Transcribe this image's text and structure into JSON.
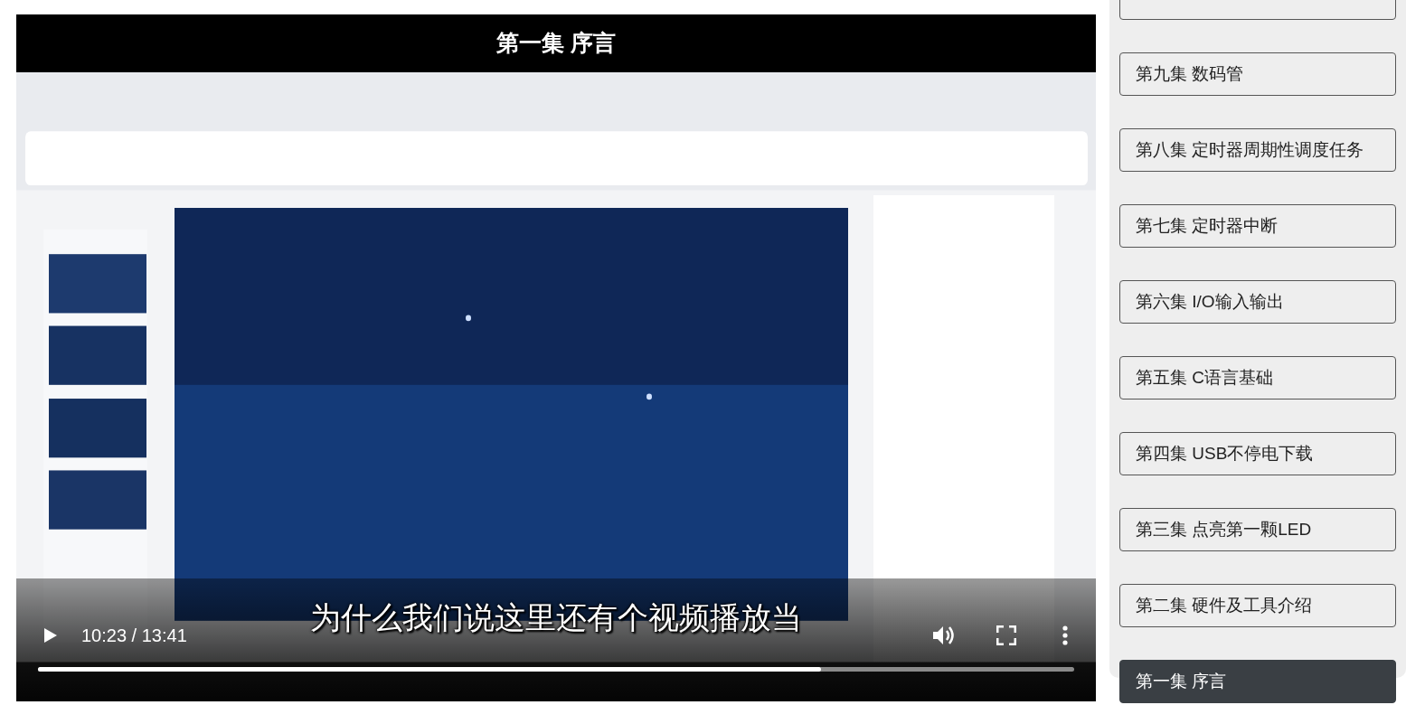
{
  "video": {
    "title": "第一集 序言",
    "caption": "为什么我们说这里还有个视频播放当",
    "time": "10:23 / 13:41",
    "progress": {
      "level": 0.756
    }
  },
  "episodes": [
    {
      "title": "第九集 数码管",
      "selected": false
    },
    {
      "title": "第八集 定时器周期性调度任务",
      "selected": false
    },
    {
      "title": "第七集 定时器中断",
      "selected": false
    },
    {
      "title": "第六集 I/O输入输出",
      "selected": false
    },
    {
      "title": "第五集 C语言基础",
      "selected": false
    },
    {
      "title": "第四集 USB不停电下载",
      "selected": false
    },
    {
      "title": "第三集 点亮第一颗LED",
      "selected": false
    },
    {
      "title": "第二集 硬件及工具介绍",
      "selected": false
    },
    {
      "title": "第一集 序言",
      "selected": true
    }
  ]
}
